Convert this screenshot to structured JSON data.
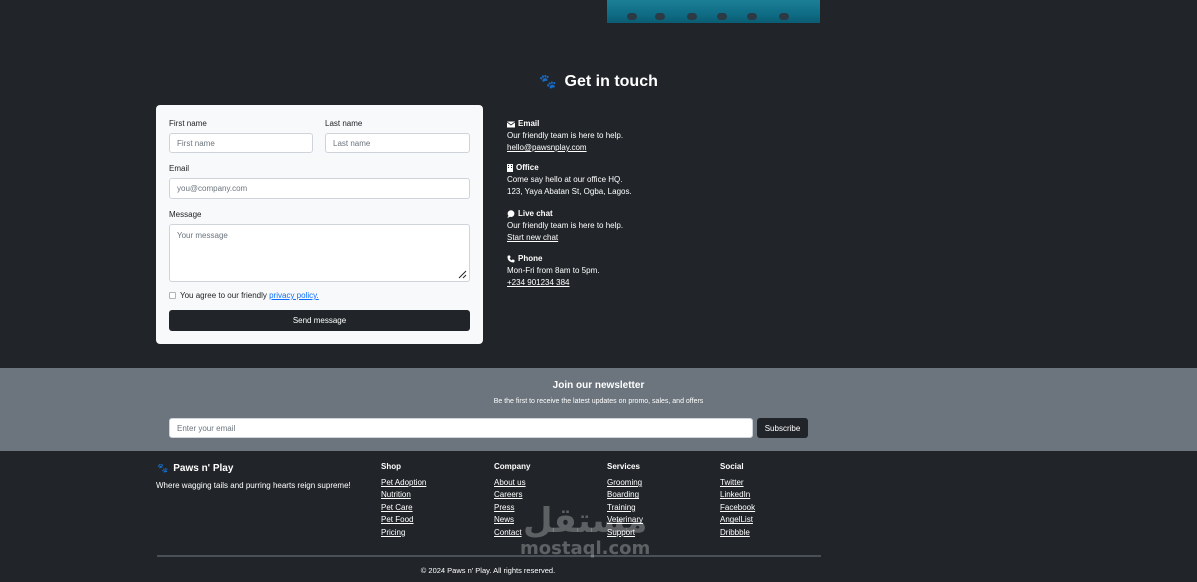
{
  "contact": {
    "title": "Get in touch",
    "first_name_label": "First name",
    "first_name_placeholder": "First name",
    "last_name_label": "Last name",
    "last_name_placeholder": "Last name",
    "email_label": "Email",
    "email_placeholder": "you@company.com",
    "message_label": "Message",
    "message_placeholder": "Your message",
    "agree_text": "You agree to our friendly",
    "privacy_link": "privacy policy.",
    "send_label": "Send message"
  },
  "info": [
    {
      "icon": "envelope-icon",
      "title": "Email",
      "text": "Our friendly team is here to help.",
      "link": "hello@pawsnplay.com"
    },
    {
      "icon": "building-icon",
      "title": "Office",
      "text": "Come say hello at our office HQ.",
      "text2": "123, Yaya Abatan St, Ogba, Lagos."
    },
    {
      "icon": "chat-icon",
      "title": "Live chat",
      "text": "Our friendly team is here to help.",
      "link": "Start new chat"
    },
    {
      "icon": "phone-icon",
      "title": "Phone",
      "text": "Mon-Fri from 8am to 5pm.",
      "link": "+234 901234 384"
    }
  ],
  "newsletter": {
    "title": "Join our newsletter",
    "subtitle": "Be the first to receive the latest updates on promo, sales, and offers",
    "placeholder": "Enter your email",
    "button": "Subscribe"
  },
  "footer": {
    "brand": "Paws n' Play",
    "tagline": "Where wagging tails and purring hearts reign supreme!",
    "columns": [
      {
        "title": "Shop",
        "items": [
          "Pet Adoption",
          "Nutrition",
          "Pet Care",
          "Pet Food",
          "Pricing"
        ]
      },
      {
        "title": "Company",
        "items": [
          "About us",
          "Careers",
          "Press",
          "News",
          "Contact"
        ]
      },
      {
        "title": "Services",
        "items": [
          "Grooming",
          "Boarding",
          "Training",
          "Veterinary",
          "Support"
        ]
      },
      {
        "title": "Social",
        "items": [
          "Twitter",
          "LinkedIn",
          "Facebook",
          "AngelList",
          "Dribbble"
        ]
      }
    ],
    "copyright": "© 2024 Paws n' Play. All rights reserved."
  },
  "watermark": {
    "arabic": "مستقل",
    "latin": "mostaql.com"
  }
}
